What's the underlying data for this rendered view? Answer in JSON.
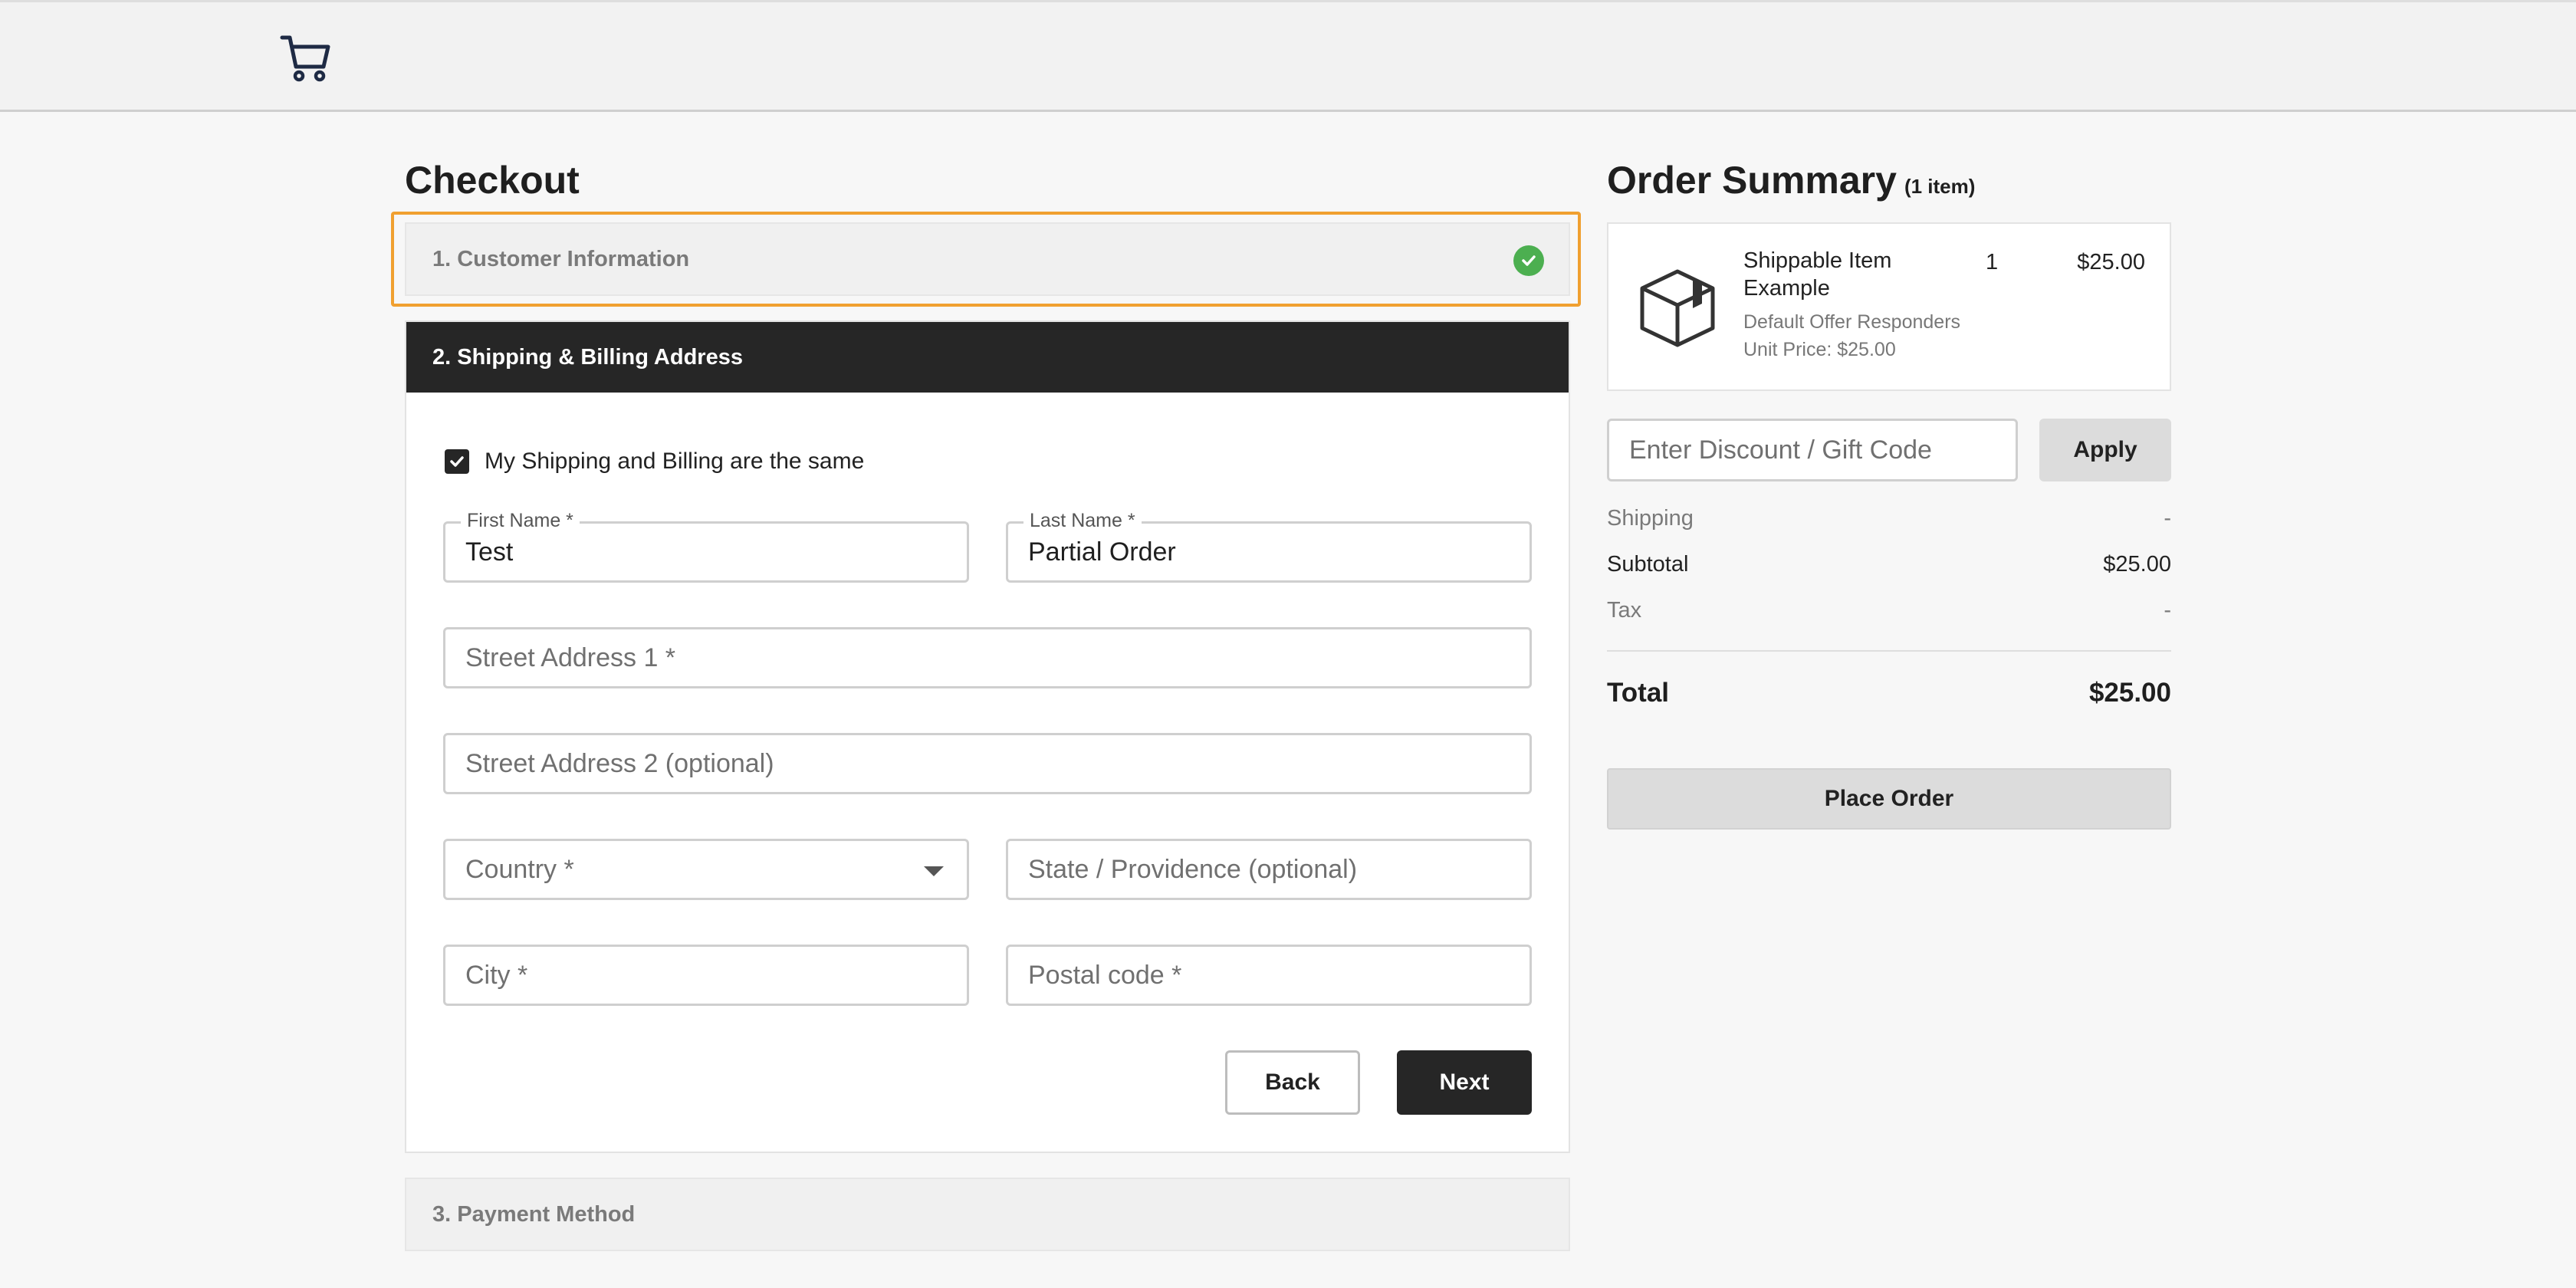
{
  "header": {
    "cart_icon": "cart-icon"
  },
  "checkout": {
    "title": "Checkout",
    "step1": {
      "label": "1. Customer Information",
      "status_icon": "check-circle-icon",
      "status_color": "#4caf50",
      "highlight_color": "#f0a030"
    },
    "step2": {
      "label": "2. Shipping & Billing Address",
      "same_checkbox": {
        "label": "My Shipping and Billing are the same",
        "checked": true
      },
      "first_name": {
        "label": "First Name *",
        "value": "Test"
      },
      "last_name": {
        "label": "Last Name *",
        "value": "Partial Order"
      },
      "street1": {
        "placeholder": "Street Address 1 *"
      },
      "street2": {
        "placeholder": "Street Address 2 (optional)"
      },
      "country": {
        "placeholder": "Country *"
      },
      "state": {
        "placeholder": "State / Providence (optional)"
      },
      "city": {
        "placeholder": "City *"
      },
      "postal": {
        "placeholder": "Postal code *"
      },
      "back_label": "Back",
      "next_label": "Next"
    },
    "step3": {
      "label": "3. Payment Method"
    }
  },
  "summary": {
    "title": "Order Summary",
    "count": "(1 item)",
    "item": {
      "icon": "box-icon",
      "name": "Shippable Item Example",
      "qty": "1",
      "price": "$25.00",
      "offer": "Default Offer Responders",
      "unit_price": "Unit Price: $25.00"
    },
    "discount_placeholder": "Enter Discount / Gift Code",
    "apply_label": "Apply",
    "shipping_label": "Shipping",
    "shipping_value": "-",
    "subtotal_label": "Subtotal",
    "subtotal_value": "$25.00",
    "tax_label": "Tax",
    "tax_value": "-",
    "total_label": "Total",
    "total_value": "$25.00",
    "place_order_label": "Place Order"
  }
}
